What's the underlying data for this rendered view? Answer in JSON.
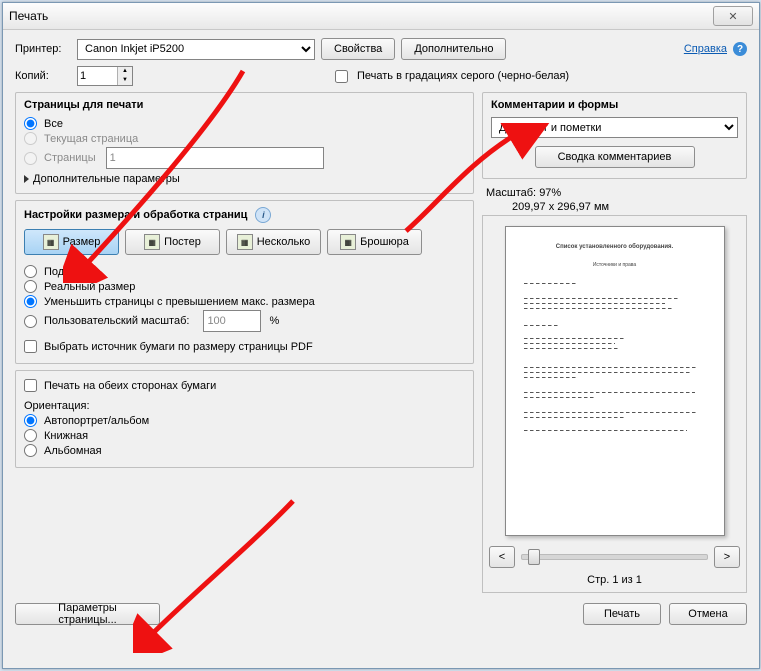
{
  "window": {
    "title": "Печать"
  },
  "top": {
    "printer_label": "Принтер:",
    "printer_value": "Canon Inkjet iP5200",
    "properties_btn": "Свойства",
    "advanced_btn": "Дополнительно",
    "help_link": "Справка",
    "copies_label": "Копий:",
    "copies_value": "1",
    "grayscale_label": "Печать в градациях серого (черно-белая)"
  },
  "pages": {
    "title": "Страницы для печати",
    "all": "Все",
    "current": "Текущая страница",
    "range_label": "Страницы",
    "range_value": "1",
    "more": "Дополнительные параметры"
  },
  "sizing": {
    "title": "Настройки размера и обработка страниц",
    "tab_size": "Размер",
    "tab_poster": "Постер",
    "tab_multiple": "Несколько",
    "tab_booklet": "Брошюра",
    "fit": "Подогнать",
    "actual": "Реальный размер",
    "shrink": "Уменьшить страницы с превышением макс. размера",
    "custom_label": "Пользовательский масштаб:",
    "custom_value": "100",
    "custom_pct": "%",
    "paper_source": "Выбрать источник бумаги по размеру страницы PDF"
  },
  "duplex": {
    "both_sides": "Печать на обеих сторонах бумаги",
    "orient_label": "Ориентация:",
    "auto": "Автопортрет/альбом",
    "portrait": "Книжная",
    "landscape": "Альбомная"
  },
  "comments": {
    "title": "Комментарии и формы",
    "value": "Документ и пометки",
    "summary_btn": "Сводка комментариев"
  },
  "preview": {
    "scale_label": "Масштаб:",
    "scale_value": "97%",
    "dims": "209,97 x 296,97 мм",
    "nav_prev": "<",
    "nav_next": ">",
    "page_info": "Стр. 1 из 1",
    "doc_title": "Список установленного оборудования.",
    "doc_sub": "Источники и права"
  },
  "footer": {
    "page_setup": "Параметры страницы...",
    "print": "Печать",
    "cancel": "Отмена"
  }
}
